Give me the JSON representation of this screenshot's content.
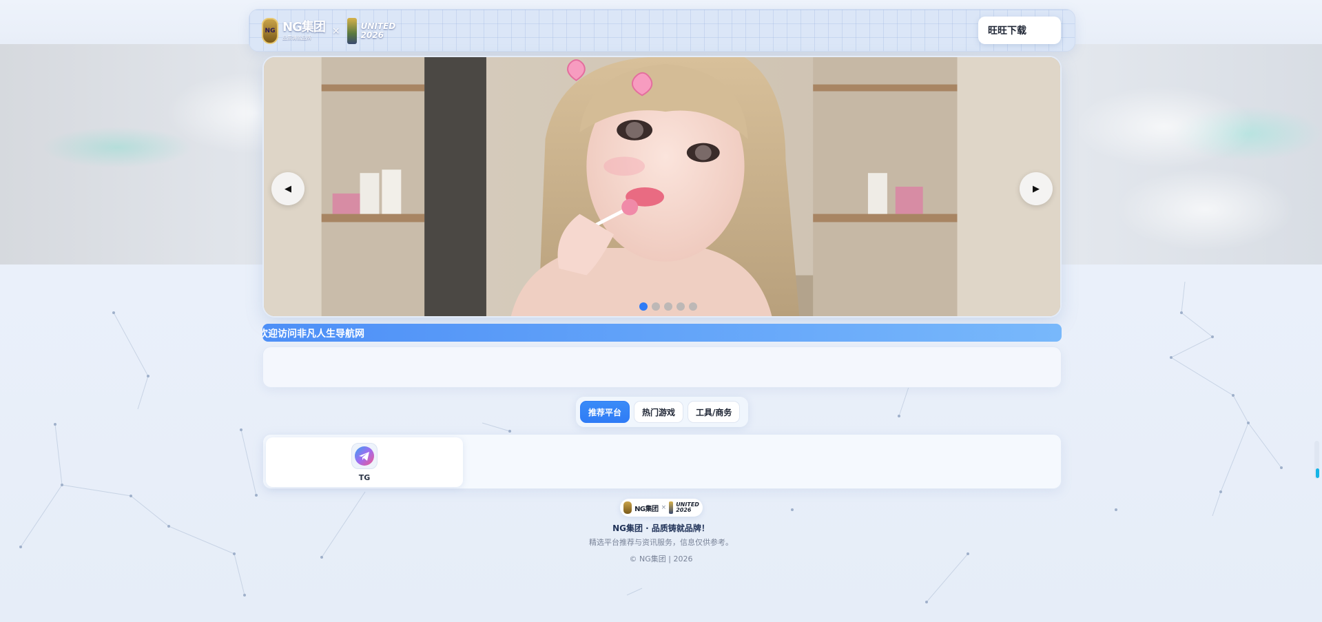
{
  "header": {
    "brand_name": "NG集团",
    "brand_sub": "品质铸就品牌",
    "emblem_text": "NG",
    "x_mark": "×",
    "partner_line1": "UNITED",
    "partner_line2": "2026",
    "download_label": "旺旺下载"
  },
  "carousel": {
    "prev_glyph": "◀",
    "next_glyph": "▶",
    "slide_count": 5,
    "active_index": 1
  },
  "marquee": {
    "text": "欢迎访问非凡人生导航网"
  },
  "tabs": [
    {
      "label": "推荐平台",
      "active": true
    },
    {
      "label": "热门游戏",
      "active": false
    },
    {
      "label": "工具/商务",
      "active": false
    }
  ],
  "platforms": [
    {
      "label": "TG",
      "icon": "telegram-icon"
    }
  ],
  "footer": {
    "brand_name": "NG集团",
    "x_mark": "×",
    "partner_line1": "UNITED",
    "partner_line2": "2026",
    "slogan": "NG集团 · 品质铸就品牌！",
    "description": "精选平台推荐与资讯服务，信息仅供参考。",
    "copyright": "© NG集团 | 2026"
  },
  "colors": {
    "accent": "#2f7cf6",
    "marquee_start": "#4d8ff7",
    "marquee_end": "#78b8fb",
    "scroll_thumb": "#15b4e6"
  }
}
